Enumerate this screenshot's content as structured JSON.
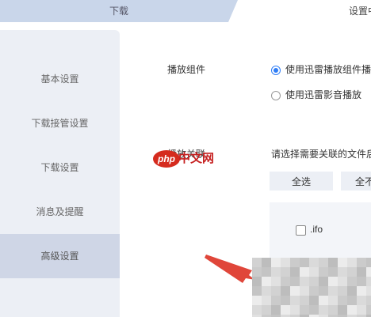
{
  "tabs": {
    "download": "下载",
    "settings": "设置中"
  },
  "sidebar": {
    "items": [
      {
        "label": "基本设置",
        "active": false
      },
      {
        "label": "下载接管设置",
        "active": false
      },
      {
        "label": "下载设置",
        "active": false
      },
      {
        "label": "消息及提醒",
        "active": false
      },
      {
        "label": "高级设置",
        "active": true
      }
    ]
  },
  "playback": {
    "label": "播放组件",
    "options": [
      {
        "label": "使用迅雷播放组件播",
        "checked": true
      },
      {
        "label": "使用迅雷影音播放",
        "checked": false
      }
    ]
  },
  "association": {
    "label": "播放关联",
    "hint": "请选择需要关联的文件后",
    "select_all": "全选",
    "select_none": "全不",
    "files": [
      {
        "ext": ".ifo",
        "checked": false
      }
    ]
  },
  "watermark": {
    "badge": "php",
    "site": "中文网"
  },
  "colors": {
    "accent": "#2f7df6",
    "sidebar_bg": "#eceff5",
    "sidebar_active": "#cfd6e6",
    "tab_bg": "#c9d6ea",
    "arrow": "#e0463a"
  }
}
